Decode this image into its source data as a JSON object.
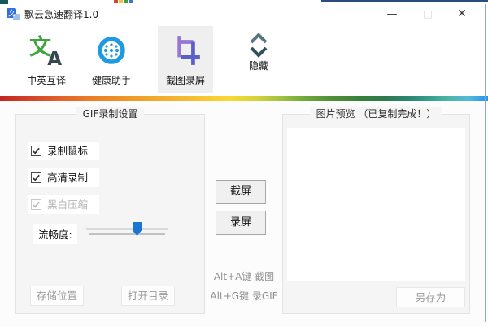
{
  "window": {
    "title": "飘云急速翻译1.0",
    "icon_glyph": "文",
    "controls": {
      "minimize": "—",
      "maximize": "□",
      "close": "✕"
    }
  },
  "toolbar": {
    "items": [
      {
        "label": "中英互译",
        "icon": "translate-icon",
        "selected": false,
        "glyphs": {
          "primary": "文",
          "secondary": "A"
        }
      },
      {
        "label": "健康助手",
        "icon": "health-icon",
        "selected": false
      },
      {
        "label": "截图录屏",
        "icon": "crop-icon",
        "selected": true
      },
      {
        "label": "隐藏",
        "icon": "hide-chevrons-icon",
        "selected": false
      }
    ]
  },
  "gif_panel": {
    "title": "GIF录制设置",
    "checkboxes": [
      {
        "label": "录制鼠标",
        "checked": true,
        "disabled": false
      },
      {
        "label": "高清录制",
        "checked": true,
        "disabled": false
      },
      {
        "label": "黑白压缩",
        "checked": true,
        "disabled": true
      }
    ],
    "slider": {
      "label": "流畅度:",
      "value_percent": 63
    },
    "buttons": {
      "storage": "存储位置",
      "open_dir": "打开目录"
    }
  },
  "center": {
    "screenshot_button": "截屏",
    "record_button": "录屏",
    "hints": [
      "Alt+A键 截图",
      "Alt+G键 录GIF"
    ]
  },
  "preview_panel": {
    "title": "图片预览 （已复制完成！）",
    "save_as_button": "另存为"
  },
  "colors": {
    "translate_green": "#3fa63f",
    "translate_dark": "#37474f",
    "health_blue": "#1e9be0",
    "crop_light": "#9678d1",
    "crop_dark": "#5a5fc9",
    "chevron_teal": "#3a545f",
    "slider_thumb": "#1b75d2",
    "selected_tab_bg": "#efefef",
    "rainbow": [
      "#c02723",
      "#e2602a",
      "#ef9327",
      "#f9d832",
      "#a8c33f",
      "#4f8f38",
      "#2e7a50",
      "#35a08c",
      "#55b8d8",
      "#2196f3"
    ]
  }
}
